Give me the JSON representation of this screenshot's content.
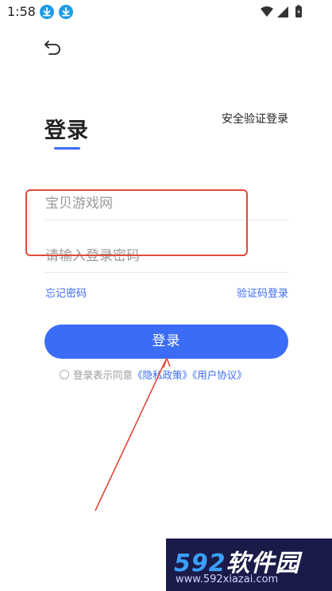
{
  "status_bar": {
    "time": "1:58",
    "icons": [
      "download-icon",
      "download-icon",
      "wifi-icon",
      "signal-icon",
      "battery-icon"
    ]
  },
  "header": {
    "back_icon": "back-arrow-icon",
    "title": "登录",
    "alt_login": "安全验证登录"
  },
  "form": {
    "account_value": "宝贝游戏网",
    "password_placeholder": "请输入登录密码",
    "forgot_password": "忘记密码",
    "sms_login": "验证码登录",
    "submit": "登录"
  },
  "agreement": {
    "prefix": "登录表示同意",
    "privacy": "《隐私政策》",
    "terms": "《用户协议》"
  },
  "watermark": {
    "digits": "592",
    "name": "软件园",
    "url": "www.592xiazai.com"
  },
  "colors": {
    "accent": "#3a6cf6",
    "annotation": "#e04a3a",
    "placeholder": "#9a9a9a"
  }
}
